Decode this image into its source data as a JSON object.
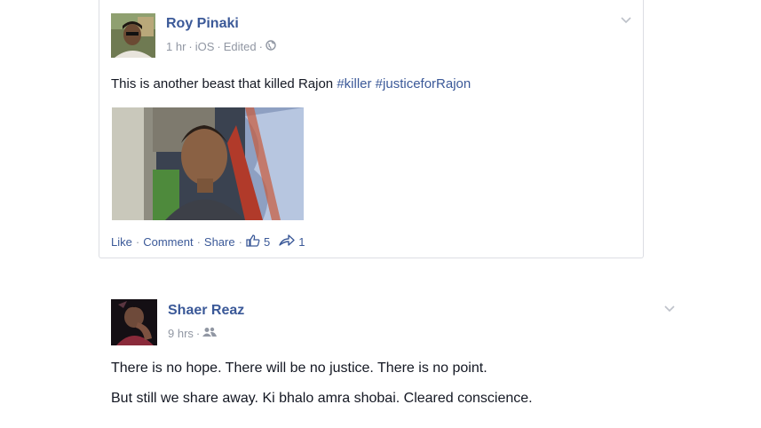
{
  "post1": {
    "author": "Roy Pinaki",
    "time": "1 hr",
    "platform": "iOS",
    "edited": "Edited",
    "text_plain": "This is another beast that killed Rajon ",
    "tag1": "#killer",
    "tag2": "#justiceforRajon",
    "actions": {
      "like": "Like",
      "comment": "Comment",
      "share": "Share",
      "likes_count": "5",
      "shares_count": "1"
    }
  },
  "post2": {
    "author": "Shaer Reaz",
    "time": "9 hrs",
    "line1": "There is no hope. There will be no justice. There is no point.",
    "line2": "But still we share away. Ki bhalo amra shobai. Cleared conscience."
  },
  "icons": {
    "globe": "globe-icon",
    "friends": "friends-icon",
    "chevron": "chevron-down-icon",
    "thumb": "thumbs-up-icon",
    "share": "share-icon"
  },
  "colors": {
    "link": "#3b5998",
    "meta": "#9197a3",
    "text": "#141823"
  }
}
